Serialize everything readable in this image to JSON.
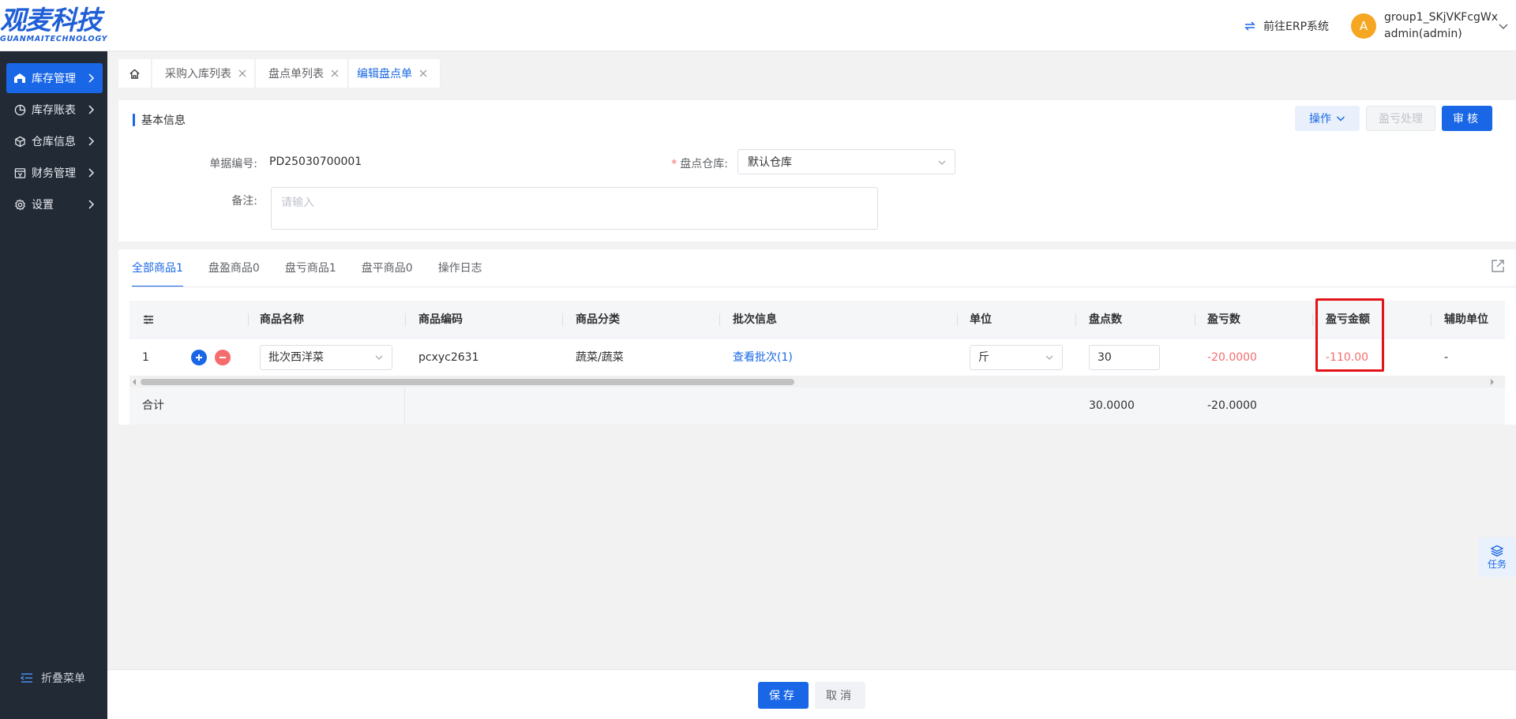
{
  "header": {
    "logo_cn": "观麦科技",
    "logo_en": "GUANMAITECHNOLOGY",
    "erp_link": "前往ERP系统",
    "avatar_letter": "A",
    "user_group": "group1_SKjVKFcgWx",
    "user_name": "admin(admin)"
  },
  "sidebar": {
    "items": [
      {
        "label": "库存管理",
        "icon": "warehouse-icon",
        "active": true
      },
      {
        "label": "库存账表",
        "icon": "pie-chart-icon",
        "active": false
      },
      {
        "label": "仓库信息",
        "icon": "box-icon",
        "active": false
      },
      {
        "label": "财务管理",
        "icon": "finance-icon",
        "active": false
      },
      {
        "label": "设置",
        "icon": "gear-icon",
        "active": false
      }
    ],
    "collapse_label": "折叠菜单"
  },
  "tabs": [
    {
      "label": "采购入库列表",
      "active": false
    },
    {
      "label": "盘点单列表",
      "active": false
    },
    {
      "label": "编辑盘点单",
      "active": true
    }
  ],
  "basic_info": {
    "title": "基本信息",
    "op_button": "操作",
    "profit_loss_button": "盈亏处理",
    "audit_button": "审核",
    "doc_no_label": "单据编号:",
    "doc_no_value": "PD25030700001",
    "warehouse_label": "盘点仓库:",
    "warehouse_value": "默认仓库",
    "remark_label": "备注:",
    "remark_placeholder": "请输入"
  },
  "product_tabs": [
    {
      "label": "全部商品1",
      "active": true
    },
    {
      "label": "盘盈商品0",
      "active": false
    },
    {
      "label": "盘亏商品1",
      "active": false
    },
    {
      "label": "盘平商品0",
      "active": false
    },
    {
      "label": "操作日志",
      "active": false
    }
  ],
  "table": {
    "columns": [
      "商品名称",
      "商品编码",
      "商品分类",
      "批次信息",
      "单位",
      "盘点数",
      "盈亏数",
      "盈亏金额",
      "辅助单位"
    ],
    "rows": [
      {
        "index": "1",
        "name": "批次西洋菜",
        "code": "pcxyc2631",
        "category": "蔬菜/蔬菜",
        "batch": "查看批次(1)",
        "unit": "斤",
        "count": "30",
        "diff": "-20.0000",
        "amount": "-110.00",
        "aux_unit": "-"
      }
    ],
    "footer": {
      "label": "合计",
      "count_total": "30.0000",
      "diff_total": "-20.0000"
    }
  },
  "footer": {
    "save": "保存",
    "cancel": "取消"
  },
  "task_float": "任务",
  "colors": {
    "primary": "#1967e6",
    "sidebar_bg": "#222a36",
    "negative": "#f56c6c",
    "highlight": "#e3131a"
  }
}
